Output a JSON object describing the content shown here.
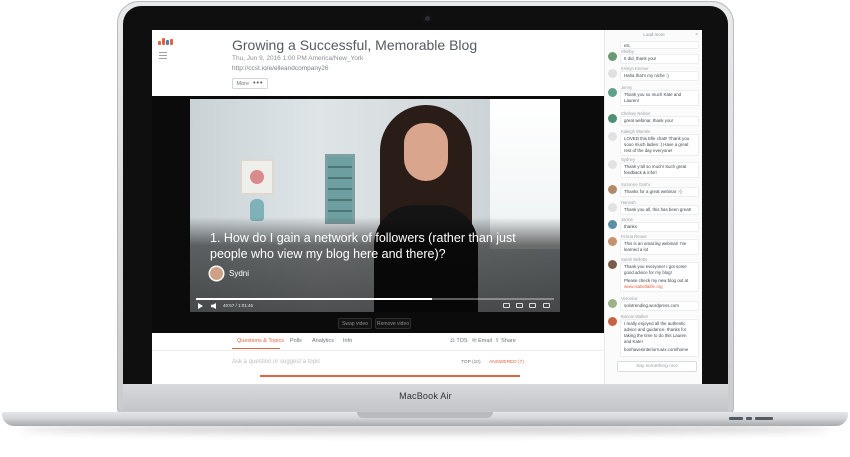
{
  "device": {
    "brand": "MacBook Air"
  },
  "header": {
    "title": "Growing a Successful, Memorable Blog",
    "datetime": "Thu, Jun 9, 2016 1:00 PM America/New_York",
    "url": "http://ccst.io/e/elleandcompany26",
    "more_label": "More",
    "more_dots": "•••"
  },
  "video": {
    "caption": "1. How do I gain a network of followers (rather than just people who view my blog here and there)?",
    "speaker": "Sydni",
    "time": "40:57 / 1:01:46",
    "progress": 0.66,
    "swap_label": "Swap video",
    "remove_label": "Remove video"
  },
  "tabs": [
    {
      "label": "Questions & Topics"
    },
    {
      "label": "Polls"
    },
    {
      "label": "Analytics"
    },
    {
      "label": "Info"
    }
  ],
  "share": {
    "tos": "TOS",
    "email": "Email",
    "share": "Share"
  },
  "questions": {
    "placeholder": "Ask a question or suggest a topic",
    "sort_top": "TOP (10)",
    "sort_answered": "ANSWERED (7)"
  },
  "chat": {
    "load_more": "Load more",
    "close": "×",
    "first_text": "etc.",
    "say_placeholder": "Say something nice",
    "messages": [
      {
        "name": "Shelby",
        "text": "It did, thank you!",
        "color": "#6a9a72"
      },
      {
        "name": "Kristyn Kromer",
        "text": "Haha that's my niche :)",
        "color": "#e0e0e0"
      },
      {
        "name": "Jenny",
        "text": "Thank you so much Kate and Lauren!",
        "color": "#5fa08a"
      },
      {
        "name": "Chelsey Nelson",
        "text": "great webinar, thank you!",
        "color": "#4f8f74"
      },
      {
        "name": "Kaleigh Warnke",
        "text": "LOVED this Elle chat!! Thank you sooo much ladies :) Have a great rest of the day everyone!",
        "color": "#e2e2e2"
      },
      {
        "name": "Sydney",
        "text": "Thank y'all so much! Such great feedback & info!!",
        "color": "#e2e2e2"
      },
      {
        "name": "Suzanne Goshi",
        "text": "Thanks for a great webinar :-)",
        "color": "#b08a6a"
      },
      {
        "name": "Hannah",
        "text": "Thank you all, this has been great!",
        "color": "#e2e2e2"
      },
      {
        "name": "Jackie",
        "text": "thanks",
        "color": "#5a8fa6"
      },
      {
        "name": "Felicia Renee",
        "text": "This is an amazing webinar! I've learned a lot",
        "color": "#c6916f"
      },
      {
        "name": "Sarah Bellotto",
        "text": "Thank you everyone! I got some good advice for my blog!",
        "text2": "Please check my new blog out at",
        "link": "www.isabellalife.org",
        "color": "#7a5c49"
      },
      {
        "name": "Veronica",
        "text": "solotrending.wordpress.com",
        "color": "#9bb28a"
      },
      {
        "name": "Bonnie Walker",
        "text": "I really enjoyed all the authentic advice and guidance- thanks for taking the time to do this Lauren and Kate!",
        "text2": "bonhaveninteriors.wix.com/home",
        "color": "#c7643f"
      }
    ]
  },
  "colors": {
    "accent": "#e2633f",
    "chat_bg": "#fbfbfc",
    "video_bg": "#0b0b0b"
  }
}
